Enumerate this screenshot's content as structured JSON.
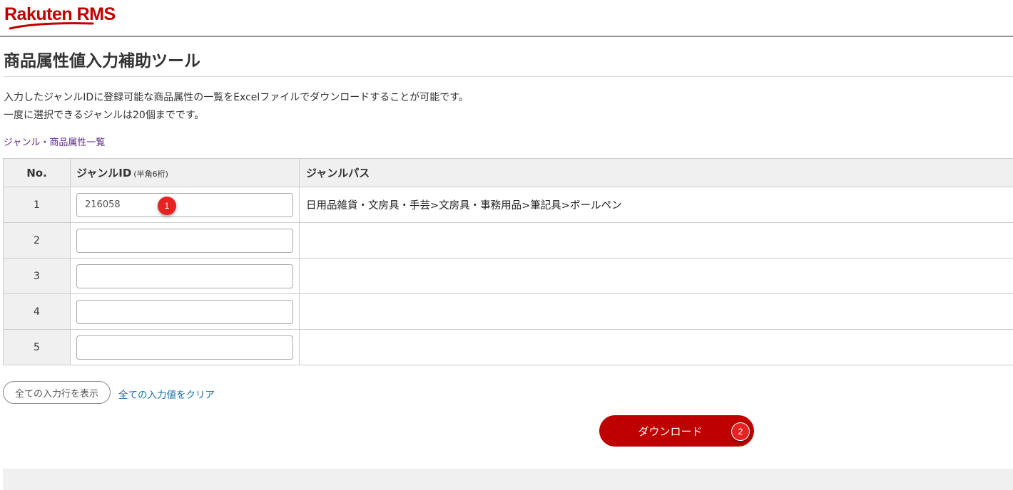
{
  "header": {
    "logo_text": "Rakuten RMS",
    "brand_color": "#bf0000"
  },
  "page": {
    "title": "商品属性値入力補助ツール",
    "description_line1": "入力したジャンルIDに登録可能な商品属性の一覧をExcelファイルでダウンロードすることが可能です。",
    "description_line2": "一度に選択できるジャンルは20個までです。",
    "genre_list_link": "ジャンル・商品属性一覧"
  },
  "table": {
    "headers": {
      "no": "No.",
      "genre_id": "ジャンルID",
      "genre_id_note": "(半角6桁)",
      "genre_path": "ジャンルパス"
    },
    "rows": [
      {
        "no": "1",
        "genre_id": "216058",
        "path": "日用品雑貨・文房具・手芸>文房具・事務用品>筆記具>ボールペン"
      },
      {
        "no": "2",
        "genre_id": "",
        "path": ""
      },
      {
        "no": "3",
        "genre_id": "",
        "path": ""
      },
      {
        "no": "4",
        "genre_id": "",
        "path": ""
      },
      {
        "no": "5",
        "genre_id": "",
        "path": ""
      }
    ]
  },
  "actions": {
    "show_all_rows": "全ての入力行を表示",
    "clear_all": "全ての入力値をクリア",
    "download": "ダウンロード"
  },
  "markers": {
    "step1": "1",
    "step2": "2"
  }
}
